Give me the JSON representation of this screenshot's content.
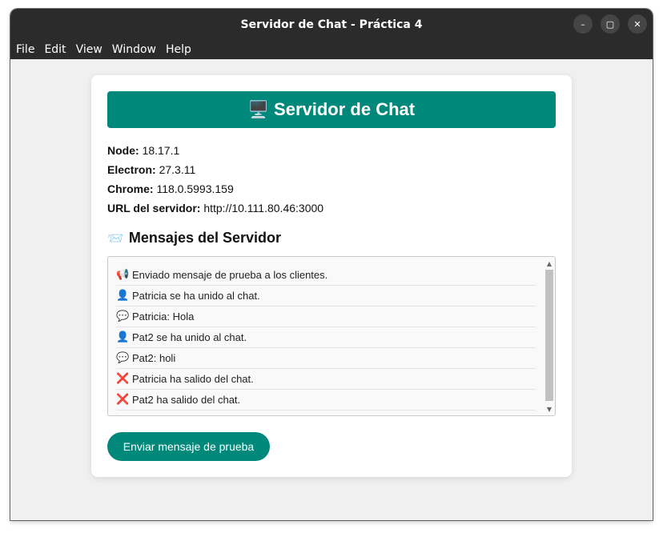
{
  "window": {
    "title": "Servidor de Chat - Práctica 4"
  },
  "window_controls": {
    "minimize": "–",
    "maximize": "▢",
    "close": "✕"
  },
  "menu": [
    "File",
    "Edit",
    "View",
    "Window",
    "Help"
  ],
  "header": {
    "icon": "🖥️",
    "title": "Servidor de Chat"
  },
  "info": [
    {
      "label": "Node:",
      "value": "18.17.1"
    },
    {
      "label": "Electron:",
      "value": "27.3.11"
    },
    {
      "label": "Chrome:",
      "value": "118.0.5993.159"
    },
    {
      "label": "URL del servidor:",
      "value": "http://10.111.80.46:3000"
    }
  ],
  "messages_section": {
    "icon": "📨",
    "title": "Mensajes del Servidor"
  },
  "log": [
    {
      "icon": "📢",
      "icon_name": "megaphone-icon",
      "text": "Enviado mensaje de prueba a los clientes."
    },
    {
      "icon": "👤",
      "icon_name": "user-icon",
      "text": "Patricia se ha unido al chat."
    },
    {
      "icon": "💬",
      "icon_name": "speech-bubble-icon",
      "text": "Patricia: Hola"
    },
    {
      "icon": "👤",
      "icon_name": "user-icon",
      "text": "Pat2 se ha unido al chat."
    },
    {
      "icon": "💬",
      "icon_name": "speech-bubble-icon",
      "text": "Pat2: holi"
    },
    {
      "icon": "❌",
      "icon_name": "cross-mark-icon",
      "text": "Patricia ha salido del chat."
    },
    {
      "icon": "❌",
      "icon_name": "cross-mark-icon",
      "text": "Pat2 ha salido del chat."
    }
  ],
  "scroll": {
    "up": "▲",
    "down": "▼"
  },
  "actions": {
    "send_test": "Enviar mensaje de prueba"
  },
  "colors": {
    "accent": "#00897b",
    "titlebar": "#2b2b2b",
    "background": "#f0f0f0"
  }
}
